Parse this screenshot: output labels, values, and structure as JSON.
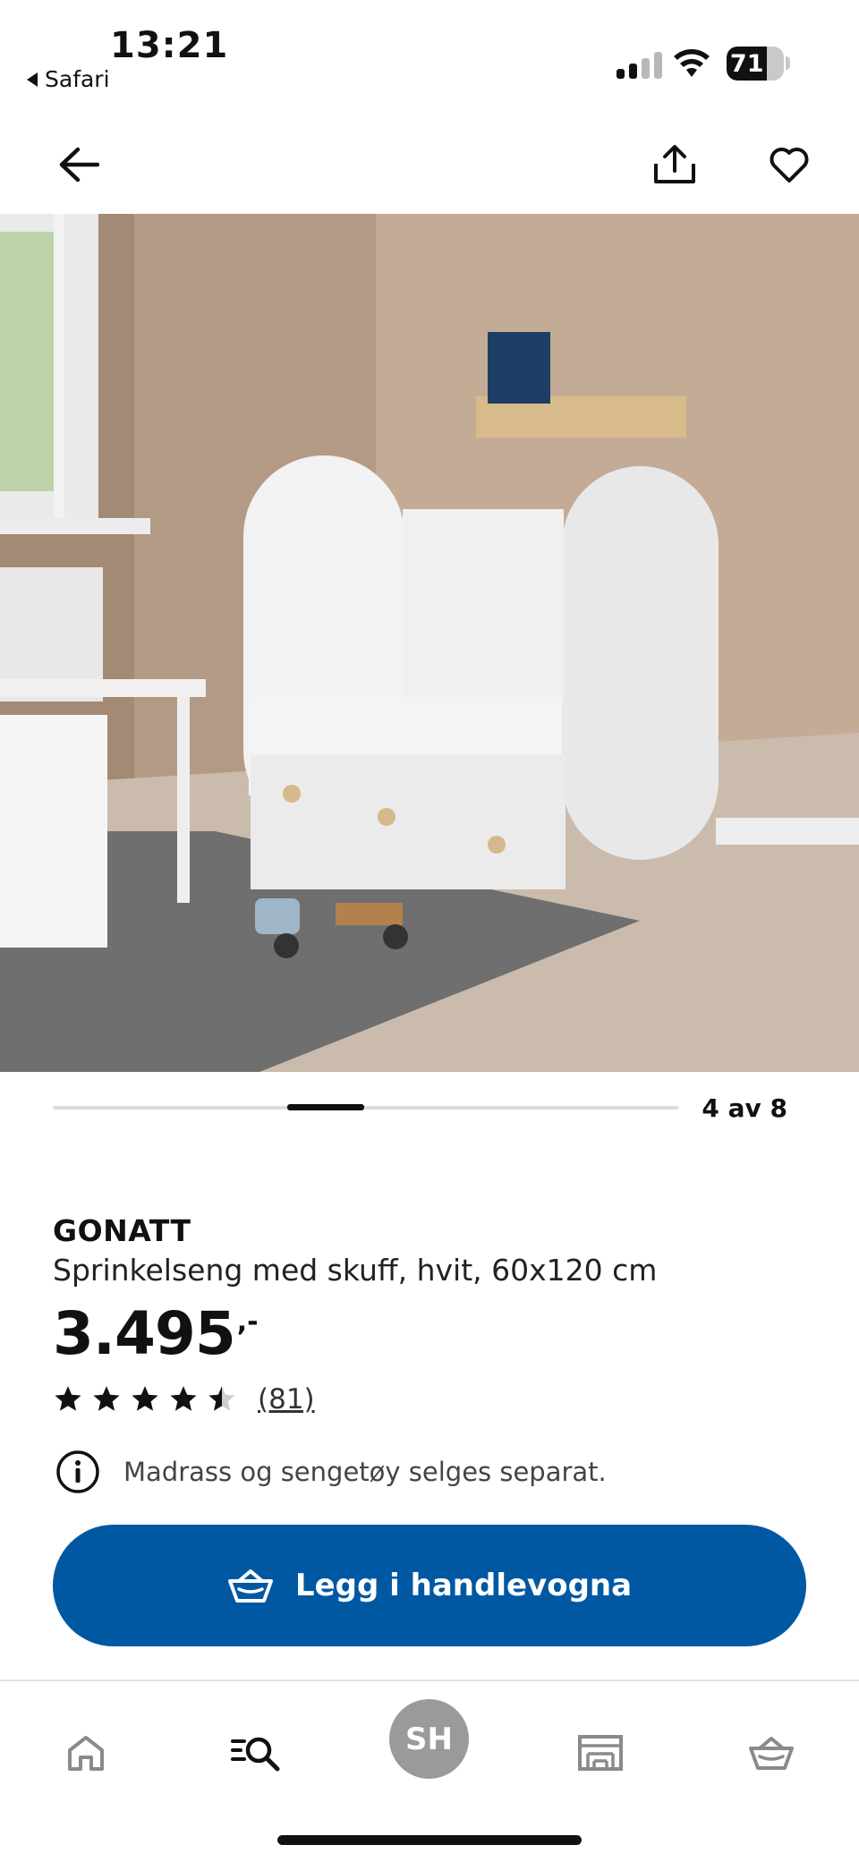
{
  "status_bar": {
    "time": "13:21",
    "back_app": "Safari",
    "battery": "71"
  },
  "nav": {
    "back_icon": "arrow-left-icon",
    "share_icon": "share-icon",
    "favorite_icon": "heart-icon"
  },
  "gallery": {
    "counter": "4 av 8",
    "current": 4,
    "total": 8
  },
  "product": {
    "brand": "GONATT",
    "description": "Sprinkelseng med skuff, hvit, 60x120 cm",
    "price": "3.495",
    "price_suffix": ",-",
    "rating": 4.5,
    "rating_max": 5,
    "review_count": "(81)",
    "notice": "Madrass og sengetøy selges separat."
  },
  "cta": {
    "label": "Legg i handlevogna",
    "icon": "basket-icon"
  },
  "tabbar": {
    "items": [
      {
        "icon": "home-icon"
      },
      {
        "icon": "search-icon"
      },
      {
        "avatar": "SH"
      },
      {
        "icon": "store-icon"
      },
      {
        "icon": "basket-icon"
      }
    ]
  },
  "colors": {
    "primary": "#0058a3",
    "avatar": "#9a9a9a"
  }
}
